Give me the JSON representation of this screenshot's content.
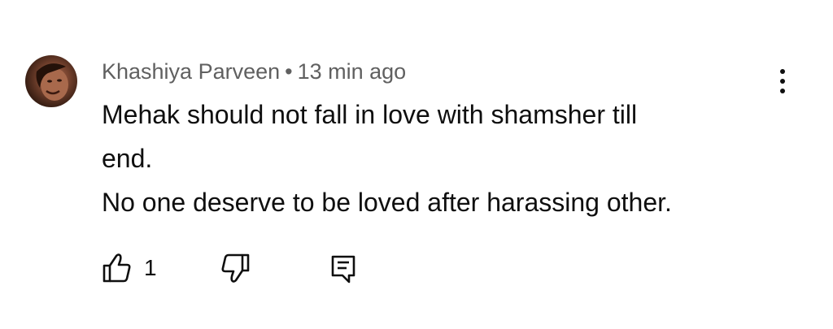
{
  "comment": {
    "author": "Khashiya Parveen",
    "separator": "•",
    "time": "13 min ago",
    "lines": [
      "Mehak should not fall in love with shamsher till",
      "end.",
      "No one deserve to be loved after harassing other."
    ],
    "like_count": "1"
  },
  "icons": {
    "avatar": "profile-photo",
    "more": "vertical-dots-icon",
    "like": "thumb-up-icon",
    "dislike": "thumb-down-icon",
    "reply": "reply-comment-icon"
  },
  "colors": {
    "background": "#ffffff",
    "meta_text": "#606060",
    "body_text": "#0f0f0f"
  }
}
